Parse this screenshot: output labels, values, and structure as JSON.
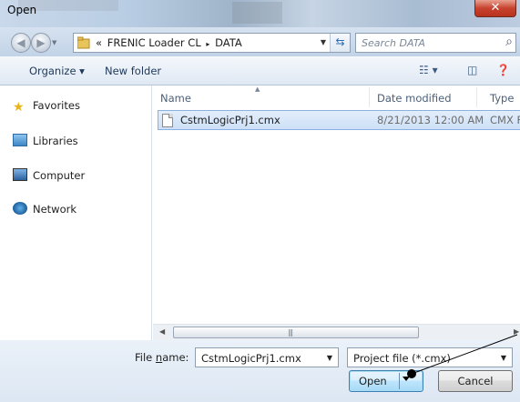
{
  "window": {
    "title": "Open",
    "close_glyph": "✕"
  },
  "nav": {
    "back_icon": "back-arrow-icon",
    "forward_icon": "forward-arrow-icon",
    "breadcrumb_prefix": "«",
    "breadcrumbs": [
      "FRENIC Loader CL",
      "DATA"
    ],
    "separator": "▸",
    "search_placeholder": "Search DATA"
  },
  "toolbar": {
    "organize_label": "Organize ▾",
    "new_folder_label": "New folder",
    "view_icon": "view-options-icon",
    "preview_icon": "preview-pane-icon",
    "help_icon": "help-icon"
  },
  "sidebar": {
    "items": [
      {
        "label": "Favorites",
        "icon": "star-icon"
      },
      {
        "label": "Libraries",
        "icon": "library-icon"
      },
      {
        "label": "Computer",
        "icon": "computer-icon"
      },
      {
        "label": "Network",
        "icon": "network-icon"
      }
    ]
  },
  "filelist": {
    "columns": [
      "Name",
      "Date modified",
      "Type"
    ],
    "rows": [
      {
        "name": "CstmLogicPrj1.cmx",
        "date": "8/21/2013 12:00 AM",
        "type": "CMX File"
      }
    ]
  },
  "footer": {
    "filename_label_pre": "File ",
    "filename_label_underline": "n",
    "filename_label_post": "ame:",
    "filename_value": "CstmLogicPrj1.cmx",
    "filetype_value": "Project file (*.cmx)",
    "open_label": "Open",
    "cancel_label": "Cancel"
  },
  "colors": {
    "accent": "#3c7fb1",
    "selection": "#cde0f7"
  }
}
